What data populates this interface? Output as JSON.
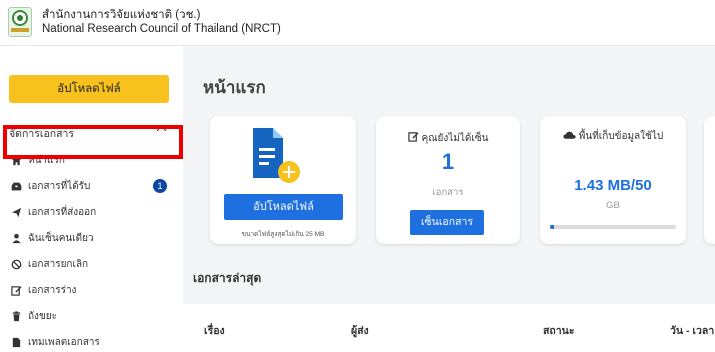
{
  "header": {
    "org_th": "สำนักงานการวิจัยแห่งชาติ (วช.)",
    "org_en": "National Research Council of Thailand (NRCT)"
  },
  "sidebar": {
    "upload_label": "อัปโหลดไฟล์",
    "section_label": "จัดการเอกสาร",
    "items": [
      {
        "label": "หน้าแรก",
        "icon": "home-icon"
      },
      {
        "label": "เอกสารที่ได้รับ",
        "icon": "inbox-icon",
        "badge": "1"
      },
      {
        "label": "เอกสารที่ส่งออก",
        "icon": "send-icon"
      },
      {
        "label": "ฉันเซ็นคนเดียว",
        "icon": "user-icon"
      },
      {
        "label": "เอกสารยกเลิก",
        "icon": "ban-icon"
      },
      {
        "label": "เอกสารร่าง",
        "icon": "edit-icon"
      },
      {
        "label": "ถังขยะ",
        "icon": "trash-icon"
      },
      {
        "label": "เทมเพลตเอกสาร",
        "icon": "file-icon"
      }
    ]
  },
  "main": {
    "page_title": "หน้าแรก",
    "upload_card": {
      "button": "อัปโหลดไฟล์",
      "note": "ขนาดไฟล์สูงสุดไม่เกิน 25 MB"
    },
    "unsigned_card": {
      "label": "คุณยังไม่ได้เซ็น",
      "count": "1",
      "unit": "เอกสาร",
      "button": "เซ็นเอกสาร"
    },
    "storage_card": {
      "label": "พื้นที่เก็บข้อมูลใช้ไป",
      "value": "1.43 MB/50",
      "unit": "GB",
      "used_fraction": 0.03
    },
    "recent_title": "เอกสารล่าสุด",
    "table_headers": [
      "เรื่อง",
      "ผู้ส่ง",
      "สถานะ",
      "วัน - เวลา"
    ]
  },
  "colors": {
    "accent_blue": "#1e6fe0",
    "upload_yellow": "#f7c21d",
    "badge_navy": "#0d47a1",
    "highlight_red": "#ee0000"
  }
}
